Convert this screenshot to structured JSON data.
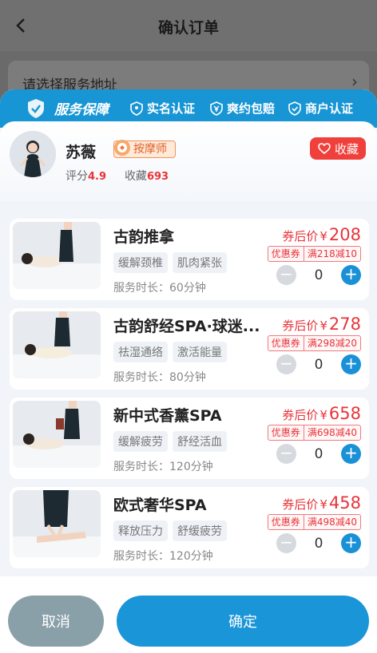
{
  "background_page": {
    "title": "确认订单",
    "address_prompt": "请选择服务地址"
  },
  "guarantee": {
    "title": "服务保障",
    "items": [
      "实名认证",
      "爽约包赔",
      "商户认证"
    ]
  },
  "therapist": {
    "name": "苏薇",
    "role": "按摩师",
    "rating_label": "评分",
    "rating": "4.9",
    "favorites_label": "收藏",
    "favorites": "693",
    "favorite_button": "收藏"
  },
  "services": [
    {
      "name": "古韵推拿",
      "tags": [
        "缓解颈椎",
        "肌肉紧张"
      ],
      "duration": "服务时长：60分钟",
      "price_label": "券后价",
      "currency": "¥",
      "price": "208",
      "coupon_label": "优惠券",
      "coupon_rule": "满218减10",
      "quantity": "0"
    },
    {
      "name": "古韵舒经SPA·球迷...",
      "tags": [
        "祛湿通络",
        "激活能量"
      ],
      "duration": "服务时长：80分钟",
      "price_label": "券后价",
      "currency": "¥",
      "price": "278",
      "coupon_label": "优惠券",
      "coupon_rule": "满298减20",
      "quantity": "0"
    },
    {
      "name": "新中式香薰SPA",
      "tags": [
        "缓解疲劳",
        "舒经活血"
      ],
      "duration": "服务时长：120分钟",
      "price_label": "券后价",
      "currency": "¥",
      "price": "658",
      "coupon_label": "优惠券",
      "coupon_rule": "满698减40",
      "quantity": "0"
    },
    {
      "name": "欧式奢华SPA",
      "tags": [
        "释放压力",
        "舒缓疲劳"
      ],
      "duration": "服务时长：120分钟",
      "price_label": "券后价",
      "currency": "¥",
      "price": "458",
      "coupon_label": "优惠券",
      "coupon_rule": "满498减40",
      "quantity": "0"
    }
  ],
  "footer": {
    "cancel": "取消",
    "confirm": "确定"
  },
  "colors": {
    "accent": "#1a95d8",
    "price": "#e8343a",
    "cancel": "#8aa0a8"
  }
}
